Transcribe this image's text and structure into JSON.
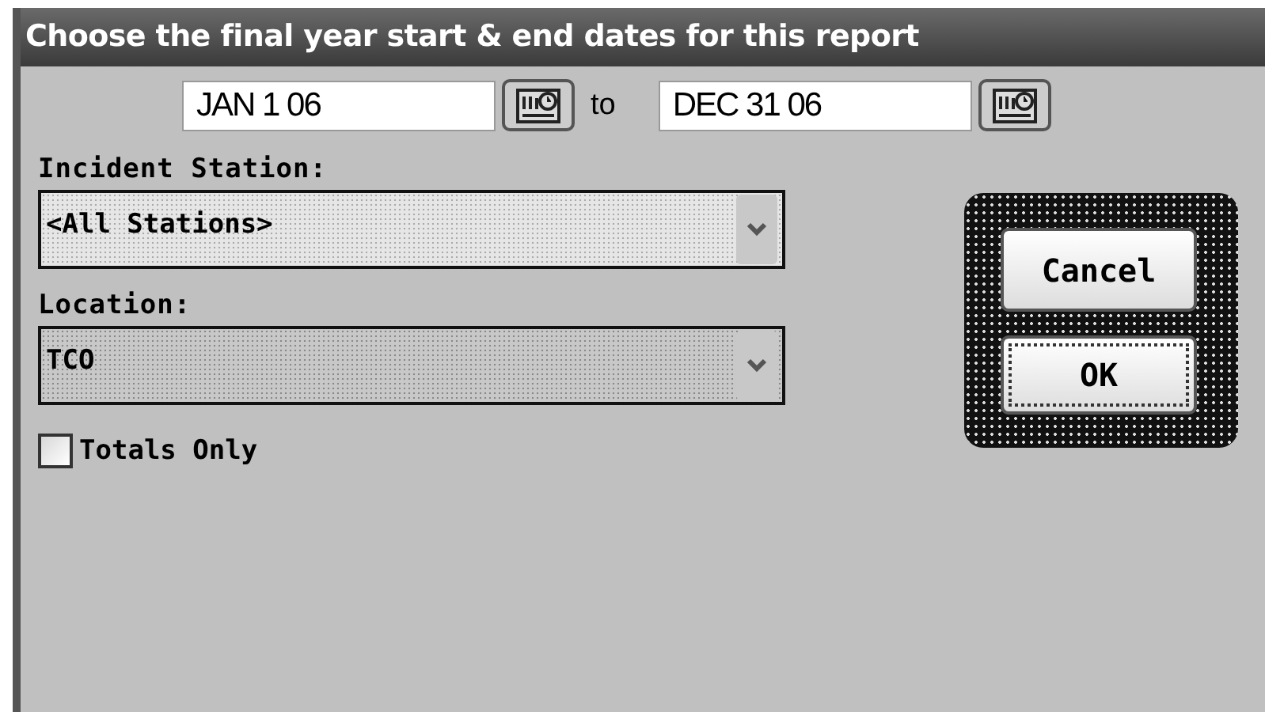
{
  "window": {
    "title": "Choose the final year start & end dates for this report"
  },
  "date_range": {
    "start": "JAN 1 06",
    "separator": "to",
    "end": "DEC 31 06"
  },
  "fields": [
    {
      "label": "Incident Station:",
      "value": "<All Stations>"
    },
    {
      "label": "Location:",
      "value": "TCO"
    }
  ],
  "totals_only": {
    "label": "Totals Only",
    "checked": false
  },
  "buttons": [
    {
      "label": "Cancel",
      "focused": false
    },
    {
      "label": "OK",
      "focused": true
    }
  ]
}
